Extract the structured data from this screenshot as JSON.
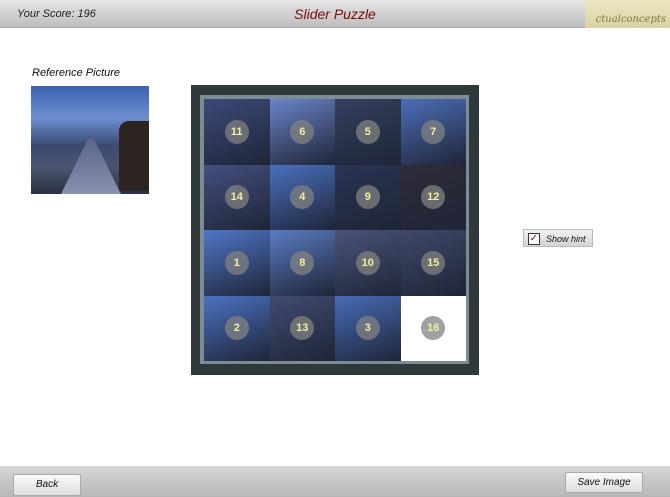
{
  "header": {
    "score_label": "Your Score: 196",
    "title": "Slider Puzzle",
    "logo_text": "ctualconcepts"
  },
  "reference": {
    "label": "Reference Picture"
  },
  "puzzle": {
    "tiles": [
      {
        "n": "11",
        "color": "#3c4a78"
      },
      {
        "n": "6",
        "color": "#6b84c8"
      },
      {
        "n": "5",
        "color": "#34405e"
      },
      {
        "n": "7",
        "color": "#4c6eb8"
      },
      {
        "n": "14",
        "color": "#434f7e"
      },
      {
        "n": "4",
        "color": "#4a70c0"
      },
      {
        "n": "9",
        "color": "#2a3452"
      },
      {
        "n": "12",
        "color": "#2e2c36"
      },
      {
        "n": "1",
        "color": "#4f77c8"
      },
      {
        "n": "8",
        "color": "#5a7cc4"
      },
      {
        "n": "10",
        "color": "#4a5478"
      },
      {
        "n": "15",
        "color": "#3f4868"
      },
      {
        "n": "2",
        "color": "#4a72c2"
      },
      {
        "n": "13",
        "color": "#414b70"
      },
      {
        "n": "3",
        "color": "#476cb8"
      },
      {
        "n": "16",
        "color": "#ffffff"
      }
    ]
  },
  "hint": {
    "label": "Show hint",
    "checked": true,
    "check_glyph": "✓"
  },
  "footer": {
    "back": "Back",
    "save": "Save Image"
  }
}
